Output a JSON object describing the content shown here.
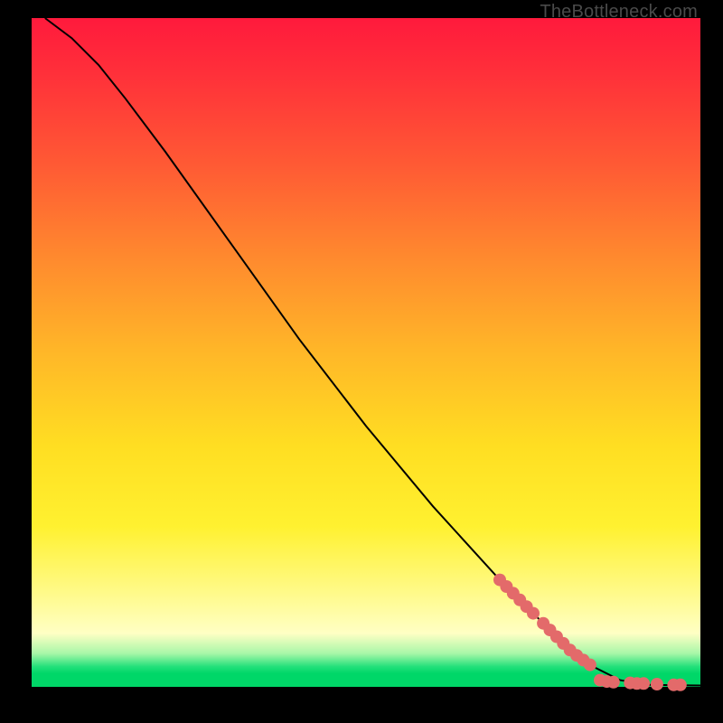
{
  "watermark": "TheBottleneck.com",
  "chart_data": {
    "type": "line",
    "title": "",
    "xlabel": "",
    "ylabel": "",
    "xlim": [
      0,
      100
    ],
    "ylim": [
      0,
      100
    ],
    "grid": false,
    "curve_points": [
      {
        "x": 2,
        "y": 100
      },
      {
        "x": 6,
        "y": 97
      },
      {
        "x": 10,
        "y": 93
      },
      {
        "x": 14,
        "y": 88
      },
      {
        "x": 20,
        "y": 80
      },
      {
        "x": 30,
        "y": 66
      },
      {
        "x": 40,
        "y": 52
      },
      {
        "x": 50,
        "y": 39
      },
      {
        "x": 60,
        "y": 27
      },
      {
        "x": 70,
        "y": 16
      },
      {
        "x": 78,
        "y": 8
      },
      {
        "x": 84,
        "y": 3
      },
      {
        "x": 88,
        "y": 1
      },
      {
        "x": 92,
        "y": 0.3
      },
      {
        "x": 100,
        "y": 0.2
      }
    ],
    "markers": [
      {
        "x": 70,
        "y": 16
      },
      {
        "x": 71,
        "y": 15
      },
      {
        "x": 72,
        "y": 14
      },
      {
        "x": 73,
        "y": 13
      },
      {
        "x": 74,
        "y": 12
      },
      {
        "x": 75,
        "y": 11
      },
      {
        "x": 76.5,
        "y": 9.5
      },
      {
        "x": 77.5,
        "y": 8.5
      },
      {
        "x": 78.5,
        "y": 7.5
      },
      {
        "x": 79.5,
        "y": 6.5
      },
      {
        "x": 80.5,
        "y": 5.5
      },
      {
        "x": 81.5,
        "y": 4.7
      },
      {
        "x": 82.5,
        "y": 4.0
      },
      {
        "x": 83.5,
        "y": 3.3
      },
      {
        "x": 85,
        "y": 1.0
      },
      {
        "x": 86,
        "y": 0.8
      },
      {
        "x": 87,
        "y": 0.7
      },
      {
        "x": 89.5,
        "y": 0.6
      },
      {
        "x": 90.5,
        "y": 0.5
      },
      {
        "x": 91.5,
        "y": 0.5
      },
      {
        "x": 93.5,
        "y": 0.4
      },
      {
        "x": 96,
        "y": 0.3
      },
      {
        "x": 97,
        "y": 0.3
      }
    ],
    "marker_color": "#e36a6a",
    "curve_color": "#000000"
  }
}
